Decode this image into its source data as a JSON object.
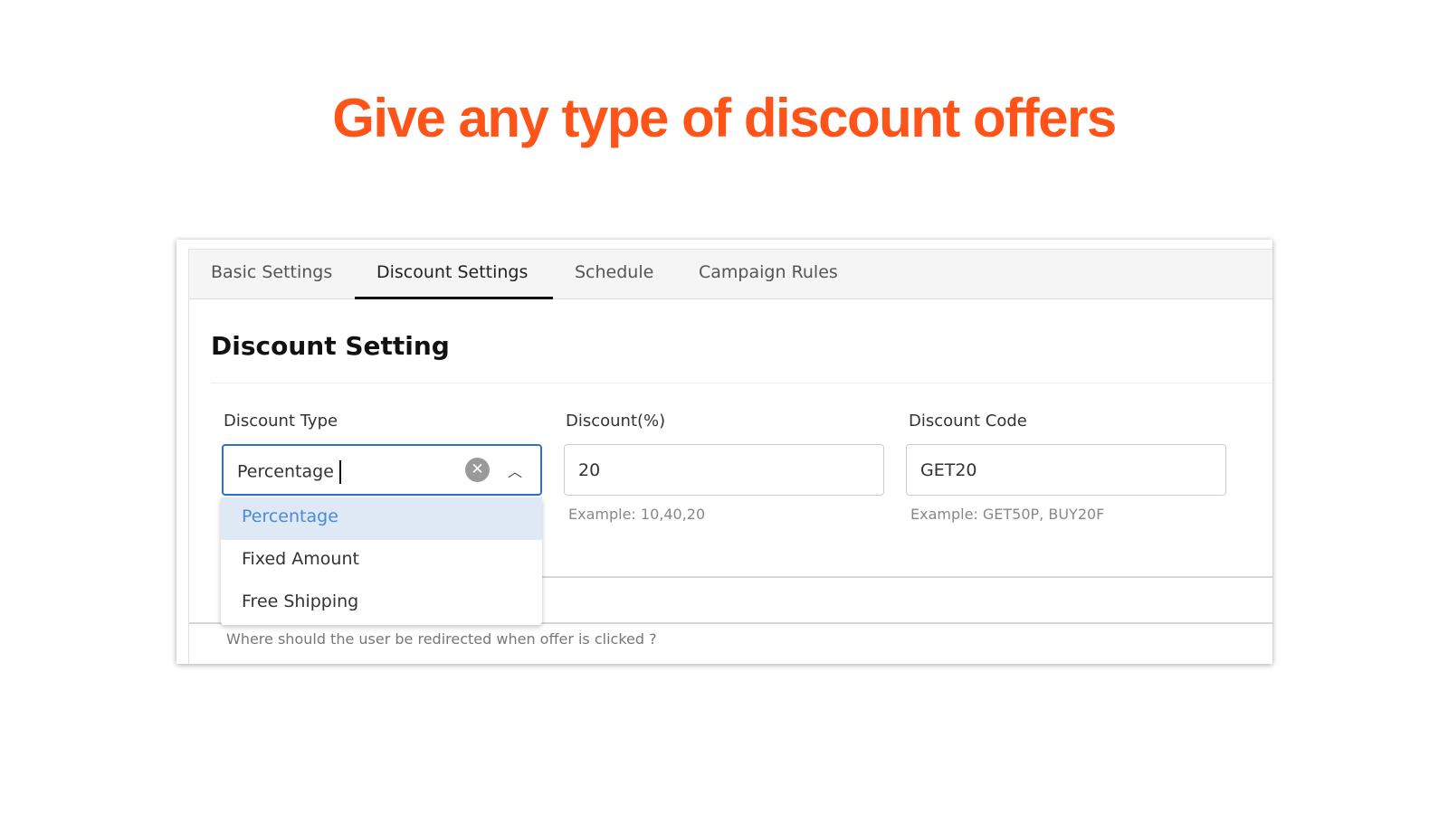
{
  "headline": "Give any type of discount offers",
  "colors": {
    "headline": "#ff5419",
    "focus": "#2a6fd6",
    "selected_option_bg": "#dfe9f5"
  },
  "tabs": [
    {
      "label": "Basic Settings"
    },
    {
      "label": "Discount Settings",
      "active": true
    },
    {
      "label": "Schedule"
    },
    {
      "label": "Campaign Rules"
    }
  ],
  "section_title": "Discount Setting",
  "fields": {
    "discount_type": {
      "label": "Discount Type",
      "value": "Percentage",
      "clear_icon": "clear-circle-icon",
      "toggle_icon": "chevron-up-icon"
    },
    "discount": {
      "label": "Discount(%)",
      "value": "20",
      "help": "Example: 10,40,20"
    },
    "discount_code": {
      "label": "Discount Code",
      "value": "GET20",
      "help": "Example: GET50P, BUY20F"
    }
  },
  "dropdown_options": [
    {
      "label": "Percentage",
      "selected": true
    },
    {
      "label": "Fixed Amount"
    },
    {
      "label": "Free Shipping"
    }
  ],
  "redirect_help": "Where should the user be redirected when offer is clicked ?"
}
